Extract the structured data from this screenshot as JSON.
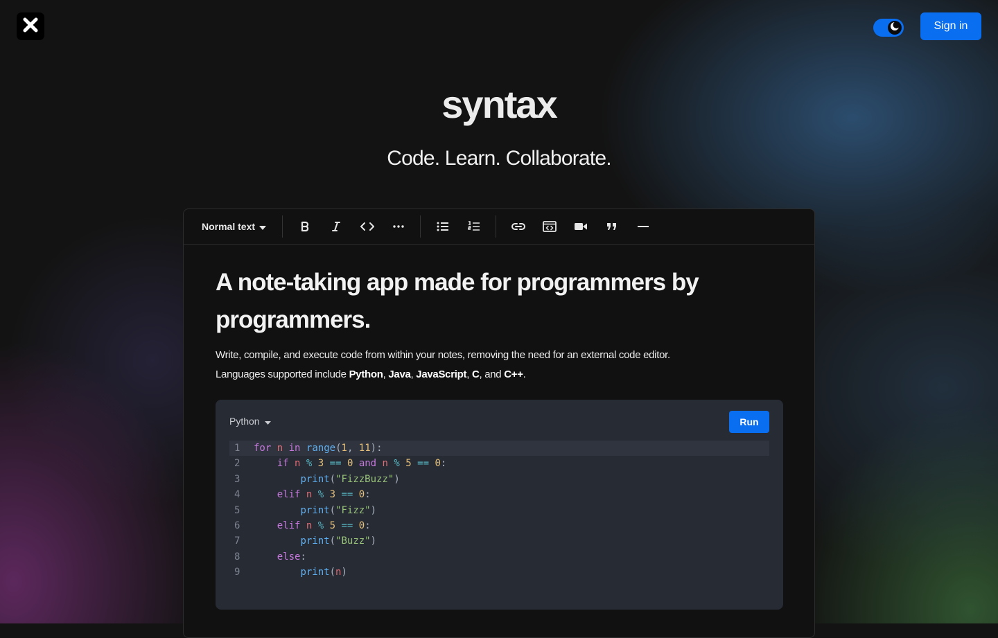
{
  "header": {
    "logo_icon": "x-close-icon",
    "theme_toggle_icon": "moon-icon",
    "signin_label": "Sign in",
    "accent_color": "#0a6ef0"
  },
  "hero": {
    "brand": "syntax",
    "tagline": "Code. Learn. Collaborate."
  },
  "toolbar": {
    "text_style": "Normal text",
    "icons": [
      "bold-icon",
      "italic-icon",
      "code-icon",
      "more-icon",
      "bullet-list-icon",
      "numbered-list-icon",
      "link-icon",
      "code-block-icon",
      "video-icon",
      "quote-icon",
      "horizontal-rule-icon"
    ]
  },
  "document": {
    "heading": "A note-taking app made for programmers by programmers.",
    "para1": "Write, compile, and execute code from within your notes, removing the need for an external code editor.",
    "para2_prefix": "Languages supported include ",
    "lang_python": "Python",
    "sep1": ", ",
    "lang_java": "Java",
    "sep2": ", ",
    "lang_js": "JavaScript",
    "sep3": ", ",
    "lang_c": "C",
    "sep4": ", and ",
    "lang_cpp": "C++",
    "para2_suffix": "."
  },
  "codeblock": {
    "language": "Python",
    "run_label": "Run",
    "lines": [
      {
        "n": "1",
        "tokens": [
          [
            "kw",
            "for"
          ],
          [
            "p",
            " "
          ],
          [
            "var",
            "n"
          ],
          [
            "p",
            " "
          ],
          [
            "kw",
            "in"
          ],
          [
            "p",
            " "
          ],
          [
            "fn",
            "range"
          ],
          [
            "p",
            "("
          ],
          [
            "num",
            "1"
          ],
          [
            "p",
            ", "
          ],
          [
            "num",
            "11"
          ],
          [
            "p",
            "):"
          ]
        ]
      },
      {
        "n": "2",
        "tokens": [
          [
            "p",
            "    "
          ],
          [
            "kw",
            "if"
          ],
          [
            "p",
            " "
          ],
          [
            "var",
            "n"
          ],
          [
            "p",
            " "
          ],
          [
            "op",
            "%"
          ],
          [
            "p",
            " "
          ],
          [
            "num",
            "3"
          ],
          [
            "p",
            " "
          ],
          [
            "op",
            "=="
          ],
          [
            "p",
            " "
          ],
          [
            "num",
            "0"
          ],
          [
            "p",
            " "
          ],
          [
            "kw",
            "and"
          ],
          [
            "p",
            " "
          ],
          [
            "var",
            "n"
          ],
          [
            "p",
            " "
          ],
          [
            "op",
            "%"
          ],
          [
            "p",
            " "
          ],
          [
            "num",
            "5"
          ],
          [
            "p",
            " "
          ],
          [
            "op",
            "=="
          ],
          [
            "p",
            " "
          ],
          [
            "num",
            "0"
          ],
          [
            "p",
            ":"
          ]
        ]
      },
      {
        "n": "3",
        "tokens": [
          [
            "p",
            "        "
          ],
          [
            "fn",
            "print"
          ],
          [
            "p",
            "("
          ],
          [
            "str",
            "\"FizzBuzz\""
          ],
          [
            "p",
            ")"
          ]
        ]
      },
      {
        "n": "4",
        "tokens": [
          [
            "p",
            "    "
          ],
          [
            "kw",
            "elif"
          ],
          [
            "p",
            " "
          ],
          [
            "var",
            "n"
          ],
          [
            "p",
            " "
          ],
          [
            "op",
            "%"
          ],
          [
            "p",
            " "
          ],
          [
            "num",
            "3"
          ],
          [
            "p",
            " "
          ],
          [
            "op",
            "=="
          ],
          [
            "p",
            " "
          ],
          [
            "num",
            "0"
          ],
          [
            "p",
            ":"
          ]
        ]
      },
      {
        "n": "5",
        "tokens": [
          [
            "p",
            "        "
          ],
          [
            "fn",
            "print"
          ],
          [
            "p",
            "("
          ],
          [
            "str",
            "\"Fizz\""
          ],
          [
            "p",
            ")"
          ]
        ]
      },
      {
        "n": "6",
        "tokens": [
          [
            "p",
            "    "
          ],
          [
            "kw",
            "elif"
          ],
          [
            "p",
            " "
          ],
          [
            "var",
            "n"
          ],
          [
            "p",
            " "
          ],
          [
            "op",
            "%"
          ],
          [
            "p",
            " "
          ],
          [
            "num",
            "5"
          ],
          [
            "p",
            " "
          ],
          [
            "op",
            "=="
          ],
          [
            "p",
            " "
          ],
          [
            "num",
            "0"
          ],
          [
            "p",
            ":"
          ]
        ]
      },
      {
        "n": "7",
        "tokens": [
          [
            "p",
            "        "
          ],
          [
            "fn",
            "print"
          ],
          [
            "p",
            "("
          ],
          [
            "str",
            "\"Buzz\""
          ],
          [
            "p",
            ")"
          ]
        ]
      },
      {
        "n": "8",
        "tokens": [
          [
            "p",
            "    "
          ],
          [
            "kw",
            "else"
          ],
          [
            "p",
            ":"
          ]
        ]
      },
      {
        "n": "9",
        "tokens": [
          [
            "p",
            "        "
          ],
          [
            "fn",
            "print"
          ],
          [
            "p",
            "("
          ],
          [
            "var",
            "n"
          ],
          [
            "p",
            ")"
          ]
        ]
      }
    ]
  }
}
